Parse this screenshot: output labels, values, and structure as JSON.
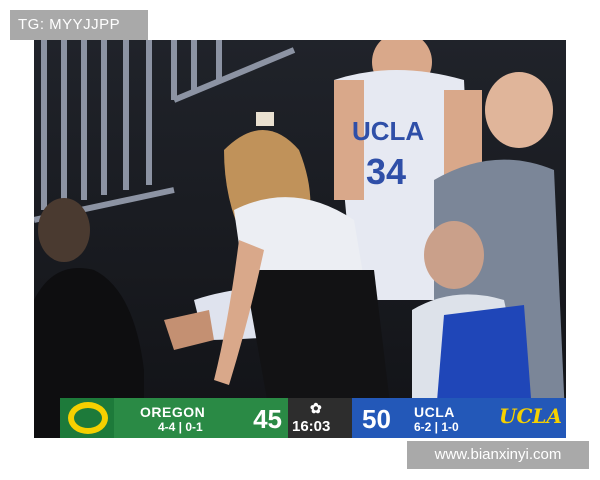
{
  "watermarks": {
    "top_left": "TG: MYYJJPP",
    "bottom_right": "www.bianxinyi.com"
  },
  "photo": {
    "jersey_text": "UCLA",
    "jersey_number": "34"
  },
  "scoreboard": {
    "away": {
      "team": "OREGON",
      "record": "4-4 | 0-1",
      "score": "45",
      "logo_icon": "oregon-o-logo-icon"
    },
    "clock": {
      "network_icon": "nbc-peacock-icon",
      "time": "16:03"
    },
    "home": {
      "team": "UCLA",
      "record": "6-2 | 1-0",
      "score": "50",
      "brand": "UCLA"
    },
    "colors": {
      "away": "#2a8a45",
      "home": "#2358b8",
      "accent": "#f5d000"
    }
  }
}
